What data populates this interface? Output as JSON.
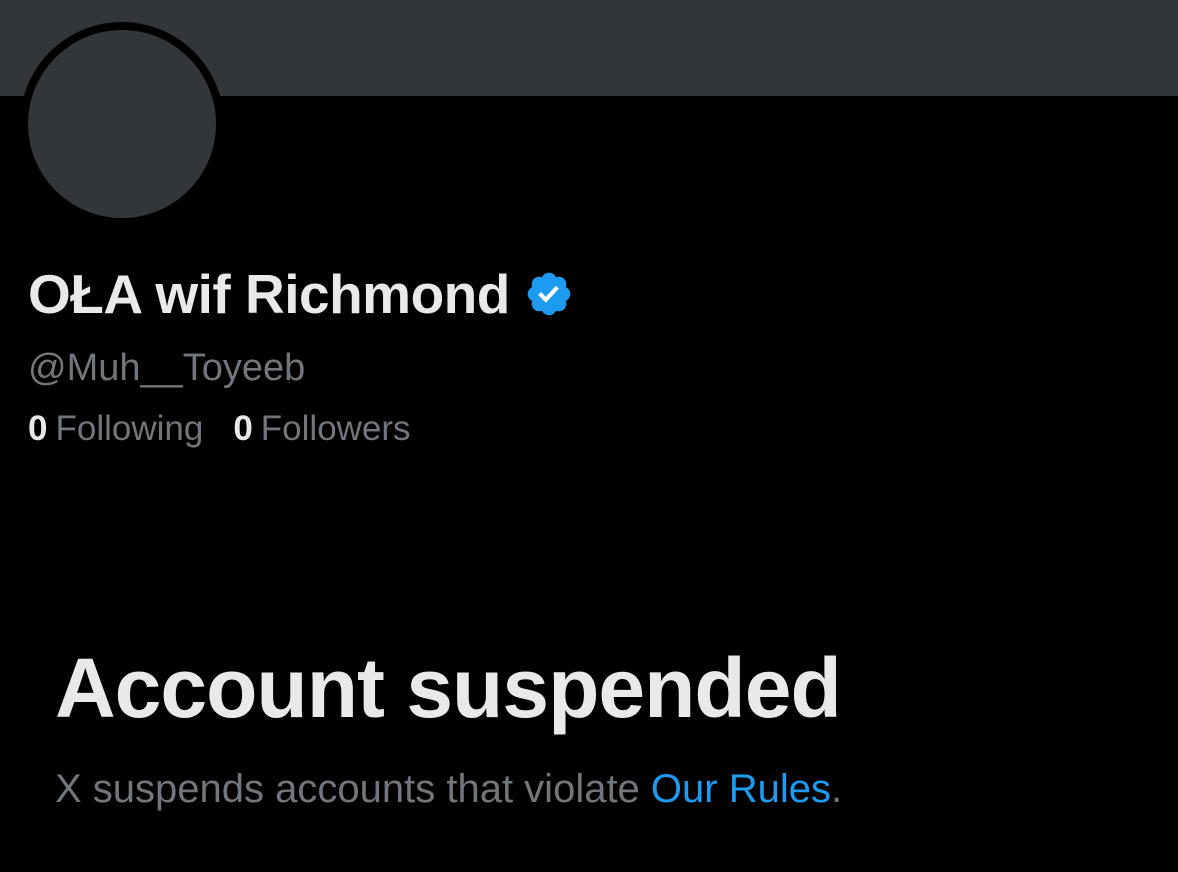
{
  "profile": {
    "display_name": "OŁA wif Richmond",
    "handle": "@Muh__Toyeeb",
    "verified_icon": "verified-badge-icon",
    "following": {
      "count": "0",
      "label": "Following"
    },
    "followers": {
      "count": "0",
      "label": "Followers"
    }
  },
  "suspension": {
    "title": "Account suspended",
    "message": "X suspends accounts that violate ",
    "link_text": "Our Rules",
    "message_end": "."
  },
  "colors": {
    "background": "#000000",
    "banner": "#333639",
    "primary_text": "#e7e9ea",
    "secondary_text": "#71767b",
    "accent": "#1d9bf0"
  }
}
